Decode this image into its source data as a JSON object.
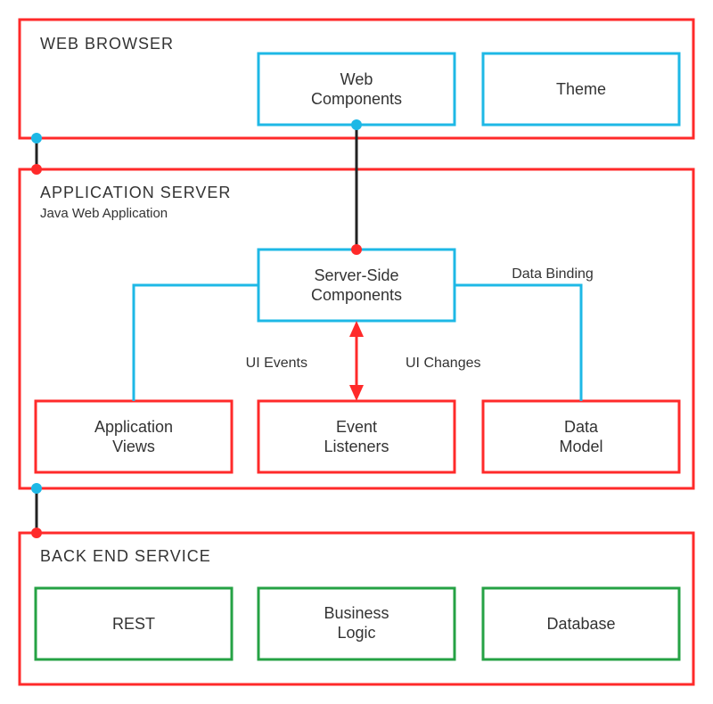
{
  "colors": {
    "red": "#ff2a2a",
    "blue": "#1eb8e6",
    "green": "#25a244",
    "black": "#222222"
  },
  "sections": {
    "browser": {
      "title": "WEB BROWSER"
    },
    "app_server": {
      "title": "APPLICATION SERVER",
      "subtitle": "Java Web Application"
    },
    "backend": {
      "title": "BACK END SERVICE"
    }
  },
  "boxes": {
    "web_components": {
      "label_l1": "Web",
      "label_l2": "Components"
    },
    "theme": {
      "label_l1": "Theme"
    },
    "server_side_components": {
      "label_l1": "Server-Side",
      "label_l2": "Components"
    },
    "application_views": {
      "label_l1": "Application",
      "label_l2": "Views"
    },
    "event_listeners": {
      "label_l1": "Event",
      "label_l2": "Listeners"
    },
    "data_model": {
      "label_l1": "Data",
      "label_l2": "Model"
    },
    "rest": {
      "label_l1": "REST"
    },
    "business_logic": {
      "label_l1": "Business",
      "label_l2": "Logic"
    },
    "database": {
      "label_l1": "Database"
    }
  },
  "edges": {
    "ui_events": "UI Events",
    "ui_changes": "UI Changes",
    "data_binding": "Data Binding"
  }
}
